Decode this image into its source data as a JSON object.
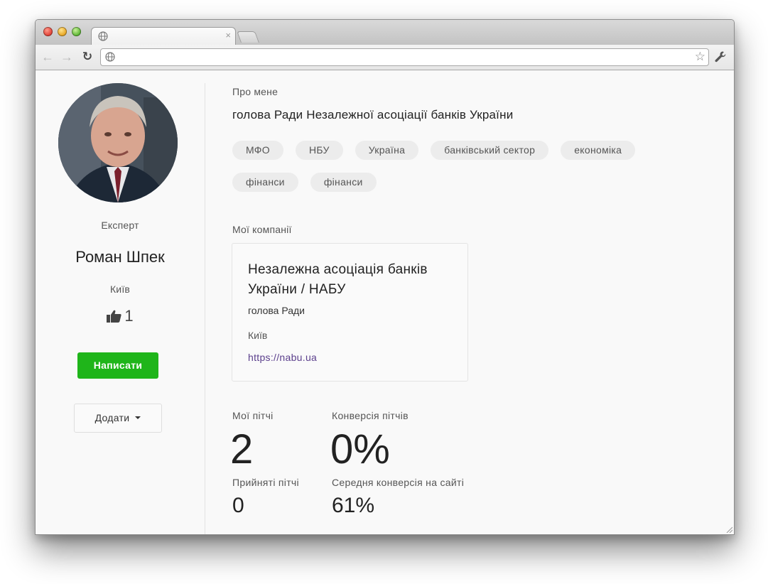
{
  "browser": {
    "tab_close": "×",
    "url": ""
  },
  "profile": {
    "role": "Експерт",
    "name": "Роман Шпек",
    "city": "Київ",
    "likes": "1",
    "write_label": "Написати",
    "add_label": "Додати"
  },
  "about": {
    "label": "Про мене",
    "text": "голова Ради Незалежної асоціації банків України",
    "tags": [
      "МФО",
      "НБУ",
      "Україна",
      "банківський сектор",
      "економіка",
      "фінанси",
      "фінанси"
    ]
  },
  "companies": {
    "label": "Мої компанії",
    "items": [
      {
        "name": "Незалежна асоціація банків України / НАБУ",
        "role": "голова Ради",
        "city": "Київ",
        "url": "https://nabu.ua"
      }
    ]
  },
  "stats": {
    "pitches_label": "Мої пітчі",
    "pitches_value": "2",
    "conversion_label": "Конверсія пітчів",
    "conversion_value": "0%",
    "accepted_label": "Прийняті пітчі",
    "accepted_value": "0",
    "avg_conversion_label": "Середня конверсія на сайті",
    "avg_conversion_value": "61%"
  },
  "colors": {
    "accent_green": "#1fb51a",
    "link_purple": "#5b3f8c"
  }
}
